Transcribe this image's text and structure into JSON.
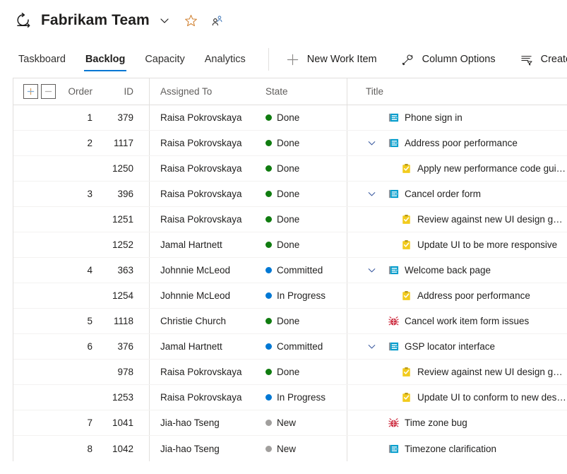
{
  "header": {
    "team_icon": "sprint-iteration-icon",
    "title": "Fabrikam Team",
    "chevron_icon": "chevron-down-icon",
    "favorite_icon": "star-icon",
    "team_members_icon": "people-icon"
  },
  "command_bar": {
    "pivots": [
      {
        "label": "Taskboard",
        "selected": false
      },
      {
        "label": "Backlog",
        "selected": true
      },
      {
        "label": "Capacity",
        "selected": false
      },
      {
        "label": "Analytics",
        "selected": false
      }
    ],
    "buttons": [
      {
        "label": "New Work Item",
        "icon": "plus-icon"
      },
      {
        "label": "Column Options",
        "icon": "wrench-icon"
      },
      {
        "label": "Create Query",
        "icon": "filter-list-icon"
      }
    ]
  },
  "grid": {
    "expand_all_label": "+",
    "collapse_all_label": "–",
    "expand_all_icon": "plus-box-icon",
    "collapse_all_icon": "minus-box-icon",
    "columns": {
      "order": "Order",
      "id": "ID",
      "assigned_to": "Assigned To",
      "state": "State",
      "title": "Title"
    },
    "state_colors": {
      "Done": "#107c10",
      "Committed": "#0078d4",
      "In Progress": "#0078d4",
      "New": "#a19f9d"
    },
    "rows": [
      {
        "order": "1",
        "id": "379",
        "assigned_to": "Raisa Pokrovskaya",
        "state": "Done",
        "title": "Phone sign in",
        "type": "user-story",
        "level": 0,
        "expander": "none"
      },
      {
        "order": "2",
        "id": "1117",
        "assigned_to": "Raisa Pokrovskaya",
        "state": "Done",
        "title": "Address poor performance",
        "type": "user-story",
        "level": 0,
        "expander": "down"
      },
      {
        "order": "",
        "id": "1250",
        "assigned_to": "Raisa Pokrovskaya",
        "state": "Done",
        "title": "Apply new performance code guidance",
        "type": "task",
        "level": 1,
        "expander": "none"
      },
      {
        "order": "3",
        "id": "396",
        "assigned_to": "Raisa Pokrovskaya",
        "state": "Done",
        "title": "Cancel order form",
        "type": "user-story",
        "level": 0,
        "expander": "down"
      },
      {
        "order": "",
        "id": "1251",
        "assigned_to": "Raisa Pokrovskaya",
        "state": "Done",
        "title": "Review against new UI design guidelines",
        "type": "task",
        "level": 1,
        "expander": "none"
      },
      {
        "order": "",
        "id": "1252",
        "assigned_to": "Jamal Hartnett",
        "state": "Done",
        "title": "Update UI to be more responsive",
        "type": "task",
        "level": 1,
        "expander": "none"
      },
      {
        "order": "4",
        "id": "363",
        "assigned_to": "Johnnie McLeod",
        "state": "Committed",
        "title": "Welcome back page",
        "type": "user-story",
        "level": 0,
        "expander": "down"
      },
      {
        "order": "",
        "id": "1254",
        "assigned_to": "Johnnie McLeod",
        "state": "In Progress",
        "title": "Address poor performance",
        "type": "task",
        "level": 1,
        "expander": "none"
      },
      {
        "order": "5",
        "id": "1118",
        "assigned_to": "Christie Church",
        "state": "Done",
        "title": "Cancel work item form issues",
        "type": "bug",
        "level": 0,
        "expander": "none"
      },
      {
        "order": "6",
        "id": "376",
        "assigned_to": "Jamal Hartnett",
        "state": "Committed",
        "title": "GSP locator interface",
        "type": "user-story",
        "level": 0,
        "expander": "down"
      },
      {
        "order": "",
        "id": "978",
        "assigned_to": "Raisa Pokrovskaya",
        "state": "Done",
        "title": "Review against new UI design guidelines",
        "type": "task",
        "level": 1,
        "expander": "none"
      },
      {
        "order": "",
        "id": "1253",
        "assigned_to": "Raisa Pokrovskaya",
        "state": "In Progress",
        "title": "Update UI to conform to new design guidelines",
        "type": "task",
        "level": 1,
        "expander": "none"
      },
      {
        "order": "7",
        "id": "1041",
        "assigned_to": "Jia-hao Tseng",
        "state": "New",
        "title": "Time zone bug",
        "type": "bug",
        "level": 0,
        "expander": "none"
      },
      {
        "order": "8",
        "id": "1042",
        "assigned_to": "Jia-hao Tseng",
        "state": "New",
        "title": "Timezone clarification",
        "type": "user-story",
        "level": 0,
        "expander": "none"
      }
    ]
  }
}
